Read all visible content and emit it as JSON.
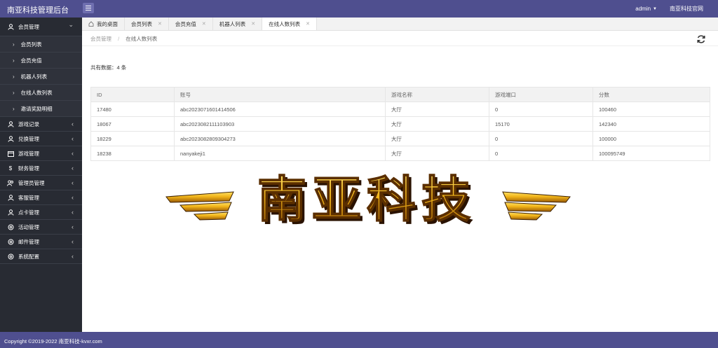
{
  "header": {
    "title": "南亚科技管理后台",
    "user": "admin",
    "site_link": "南亚科技官网"
  },
  "sidebar": {
    "groups": [
      {
        "label": "会员管理",
        "icon": "user-icon",
        "open": true,
        "items": [
          {
            "label": "会员列表"
          },
          {
            "label": "会员充值"
          },
          {
            "label": "机器人列表"
          },
          {
            "label": "在线人数列表"
          },
          {
            "label": "邀请奖励明细"
          }
        ]
      },
      {
        "label": "游戏记录",
        "icon": "user-icon"
      },
      {
        "label": "兑换管理",
        "icon": "user-icon"
      },
      {
        "label": "游戏管理",
        "icon": "calendar-icon"
      },
      {
        "label": "财务管理",
        "icon": "dollar-icon"
      },
      {
        "label": "管理员管理",
        "icon": "group-icon"
      },
      {
        "label": "客服管理",
        "icon": "support-icon"
      },
      {
        "label": "点卡管理",
        "icon": "card-icon"
      },
      {
        "label": "活动管理",
        "icon": "settings-icon"
      },
      {
        "label": "邮件管理",
        "icon": "settings-icon"
      },
      {
        "label": "系统配置",
        "icon": "settings-icon"
      }
    ]
  },
  "tabs": [
    {
      "label": "我的桌面",
      "home": true,
      "closable": false
    },
    {
      "label": "会员列表",
      "closable": true
    },
    {
      "label": "会员充值",
      "closable": true
    },
    {
      "label": "机器人列表",
      "closable": true
    },
    {
      "label": "在线人数列表",
      "closable": true,
      "active": true
    }
  ],
  "breadcrumb": {
    "parent": "会员管理",
    "sep": "/",
    "current": "在线人数列表"
  },
  "summary": {
    "label": "共有数据：4 条"
  },
  "table": {
    "columns": [
      "ID",
      "账号",
      "游戏名称",
      "游戏端口",
      "分数"
    ],
    "rows": [
      [
        "17480",
        "abc2023071601414506",
        "大厅",
        "0",
        "100460"
      ],
      [
        "18067",
        "abc2023082111103903",
        "大厅",
        "15170",
        "142340"
      ],
      [
        "18229",
        "abc2023082809304273",
        "大厅",
        "0",
        "100000"
      ],
      [
        "18238",
        "nanyakeji1",
        "大厅",
        "0",
        "100095749"
      ]
    ]
  },
  "logo": {
    "text": "南亚科技"
  },
  "footer": {
    "text": "Copyright ©2019-2022 南亚科技-kvxr.com"
  },
  "colors": {
    "header_bg": "#4f4f8f",
    "sidebar_bg": "#282b33",
    "logo_gold": "#f2b51a"
  }
}
